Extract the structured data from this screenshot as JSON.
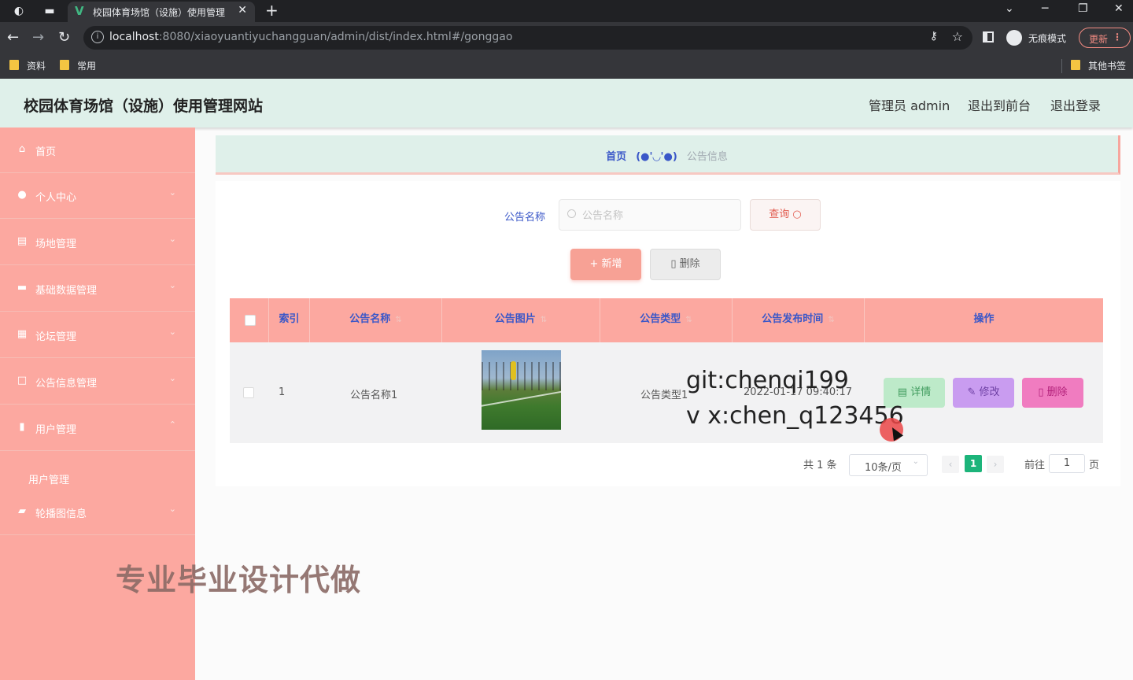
{
  "browser": {
    "tab_title": "校园体育场馆（设施）使用管理",
    "url_host": "localhost",
    "url_rest": ":8080/xiaoyuantiyuchangguan/admin/dist/index.html#/gonggao",
    "incognito_label": "无痕模式",
    "update_label": "更新",
    "bookmarks": [
      "资料",
      "常用"
    ],
    "other_bookmarks": "其他书签"
  },
  "app": {
    "title": "校园体育场馆（设施）使用管理网站",
    "header_links": [
      "管理员 admin",
      "退出到前台",
      "退出登录"
    ]
  },
  "sidebar": {
    "items": [
      {
        "label": "首页",
        "icon": "home-icon"
      },
      {
        "label": "个人中心",
        "icon": "user-icon"
      },
      {
        "label": "场地管理",
        "icon": "document-icon"
      },
      {
        "label": "基础数据管理",
        "icon": "ticket-icon"
      },
      {
        "label": "论坛管理",
        "icon": "grid-icon"
      },
      {
        "label": "公告信息管理",
        "icon": "square-icon"
      },
      {
        "label": "用户管理",
        "icon": "chart-icon"
      },
      {
        "label": "轮播图信息",
        "icon": "briefcase-icon"
      }
    ],
    "submenu": {
      "label": "用户管理"
    }
  },
  "breadcrumb": {
    "home": "首页",
    "separator": "(●'◡'●)",
    "current": "公告信息"
  },
  "search": {
    "label": "公告名称",
    "placeholder": "公告名称",
    "value": "",
    "query_button": "查询"
  },
  "actions": {
    "add": "新增",
    "delete": "删除"
  },
  "table": {
    "columns": [
      "索引",
      "公告名称",
      "公告图片",
      "公告类型",
      "公告发布时间",
      "操作"
    ],
    "rows": [
      {
        "index": "1",
        "name": "公告名称1",
        "type": "公告类型1",
        "time": "2022-01-17 09:40:17"
      }
    ],
    "row_actions": {
      "detail": "详情",
      "edit": "修改",
      "delete": "删除"
    }
  },
  "pagination": {
    "total": "共 1 条",
    "page_size": "10条/页",
    "current": "1",
    "goto_label": "前往",
    "goto_value": "1",
    "page_unit": "页"
  },
  "overlay": {
    "git": "git:chenqi199",
    "wechat": "v x:chen_q123456",
    "banner": "专业毕业设计代做"
  },
  "colors": {
    "sidebar": "#fca8a0",
    "header": "#dff0ea",
    "accent_blue": "#3a57c8",
    "pager_active": "#1cb47a"
  }
}
